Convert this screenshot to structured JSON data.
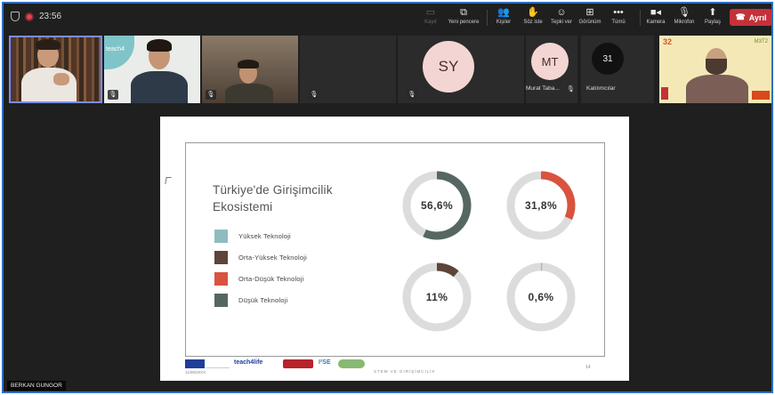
{
  "topbar": {
    "time": "23:56",
    "buttons": [
      {
        "label": "Kayıt",
        "icon": "record-icon"
      },
      {
        "label": "Yeni pencere",
        "icon": "new-window-icon"
      },
      {
        "label": "Kişiler",
        "icon": "people-icon"
      },
      {
        "label": "Söz iste",
        "icon": "raise-hand-icon"
      },
      {
        "label": "Tepki ver",
        "icon": "reaction-icon"
      },
      {
        "label": "Görünüm",
        "icon": "view-icon"
      },
      {
        "label": "Tümü",
        "icon": "more-icon"
      },
      {
        "label": "Kamera",
        "icon": "camera-icon"
      },
      {
        "label": "Mikrofon",
        "icon": "microphone-icon"
      },
      {
        "label": "Paylaş",
        "icon": "share-icon"
      }
    ],
    "leave_label": "Ayrıl"
  },
  "participants": {
    "avatar_sy": "SY",
    "avatar_mt": "MT",
    "mt_name": "Murat Taba...",
    "count": "31",
    "count_label": "Katılımcılar",
    "tile2_logo": "teach4",
    "tile5_logo": "32",
    "tile5_logo2": "M3T2"
  },
  "slide": {
    "title_line1": "Türkiye'de Girişimcilik",
    "title_line2": "Ekosistemi",
    "legend": [
      {
        "label": "Yüksek Teknoloji",
        "color": "#8fbcc1"
      },
      {
        "label": "Orta-Yüksek Teknoloji",
        "color": "#5d4538"
      },
      {
        "label": "Orta-Düşük Teknoloji",
        "color": "#d9533f"
      },
      {
        "label": "Düşük Teknoloji",
        "color": "#566663"
      }
    ],
    "donuts": [
      {
        "label": "56,6%",
        "value": 56.6,
        "color": "#566663"
      },
      {
        "label": "31,8%",
        "value": 31.8,
        "color": "#d9533f"
      },
      {
        "label": "11%",
        "value": 11,
        "color": "#5d4538"
      },
      {
        "label": "0,6%",
        "value": 0.6,
        "color": "#8fbcc1"
      }
    ],
    "footer_logos": [
      "teach4life",
      "I²SE"
    ],
    "footer_date": "11/08/20XX",
    "footer_text": "STEM VE GİRİŞİMCİLİK",
    "page_number": "14"
  },
  "speaker_name": "BERKAN GUNGOR"
}
